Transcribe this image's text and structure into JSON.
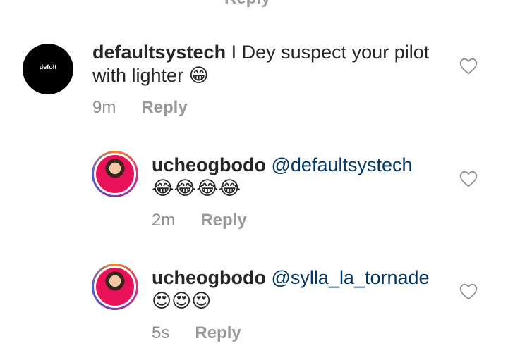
{
  "top": {
    "reply_label": "Reply"
  },
  "comments": [
    {
      "avatar_label": "defolt",
      "username": "defaultsystech",
      "mention": "",
      "text": "I Dey suspect your pilot with lighter",
      "emoji": "😁",
      "time": "9m",
      "reply_label": "Reply"
    },
    {
      "username": "ucheogbodo",
      "mention": "@defaultsystech",
      "text": "",
      "emoji": "😂😂😂😂",
      "time": "2m",
      "reply_label": "Reply"
    },
    {
      "username": "ucheogbodo",
      "mention": "@sylla_la_tornade",
      "text": "",
      "emoji": "😍😍😍",
      "time": "5s",
      "reply_label": "Reply"
    }
  ],
  "icons": {
    "like": "heart-outline-icon"
  }
}
